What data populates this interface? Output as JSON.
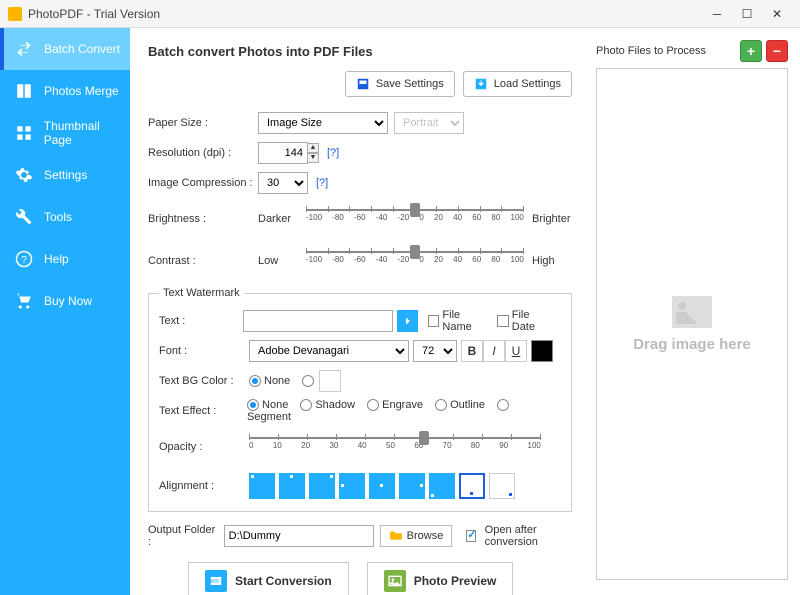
{
  "window": {
    "title": "PhotoPDF - Trial Version"
  },
  "sidebar": {
    "items": [
      {
        "label": "Batch Convert",
        "icon": "swap"
      },
      {
        "label": "Photos Merge",
        "icon": "merge"
      },
      {
        "label": "Thumbnail Page",
        "icon": "grid"
      },
      {
        "label": "Settings",
        "icon": "gear"
      },
      {
        "label": "Tools",
        "icon": "wrench"
      },
      {
        "label": "Help",
        "icon": "help"
      },
      {
        "label": "Buy Now",
        "icon": "cart"
      }
    ]
  },
  "content": {
    "heading": "Batch convert Photos into PDF Files",
    "save_settings": "Save Settings",
    "load_settings": "Load Settings",
    "paper_size": {
      "label": "Paper Size :",
      "value": "Image Size",
      "orientation": "Portrait"
    },
    "resolution": {
      "label": "Resolution (dpi) :",
      "value": "144",
      "help": "[?]"
    },
    "compression": {
      "label": "Image Compression :",
      "value": "30",
      "help": "[?]"
    },
    "brightness": {
      "label": "Brightness :",
      "left": "Darker",
      "right": "Brighter",
      "value": 0,
      "min": -100,
      "max": 100
    },
    "contrast": {
      "label": "Contrast :",
      "left": "Low",
      "right": "High",
      "value": 0,
      "min": -100,
      "max": 100
    },
    "watermark": {
      "legend": "Text Watermark",
      "text_label": "Text :",
      "text_value": "",
      "file_name": "File Name",
      "file_date": "File Date",
      "font_label": "Font :",
      "font_value": "Adobe Devanagari",
      "font_size": "72",
      "bold": "B",
      "italic": "I",
      "underline": "U",
      "bg_label": "Text BG Color :",
      "bg_none": "None",
      "effect_label": "Text Effect :",
      "effects": [
        "None",
        "Shadow",
        "Engrave",
        "Outline",
        "Segment"
      ],
      "effect_selected": "None",
      "opacity_label": "Opacity :",
      "opacity_value": 60,
      "alignment_label": "Alignment :"
    },
    "output": {
      "label": "Output Folder :",
      "path": "D:\\Dummy",
      "browse": "Browse",
      "open_after": "Open after conversion",
      "open_after_checked": true
    },
    "actions": {
      "start": "Start Conversion",
      "preview": "Photo Preview"
    }
  },
  "right": {
    "title": "Photo Files to Process",
    "drop_hint": "Drag image here"
  },
  "slider_ticks": [
    "-100",
    "-80",
    "-60",
    "-40",
    "-20",
    "0",
    "20",
    "40",
    "60",
    "80",
    "100"
  ],
  "opacity_ticks": [
    "0",
    "10",
    "20",
    "30",
    "40",
    "50",
    "60",
    "70",
    "80",
    "90",
    "100"
  ]
}
